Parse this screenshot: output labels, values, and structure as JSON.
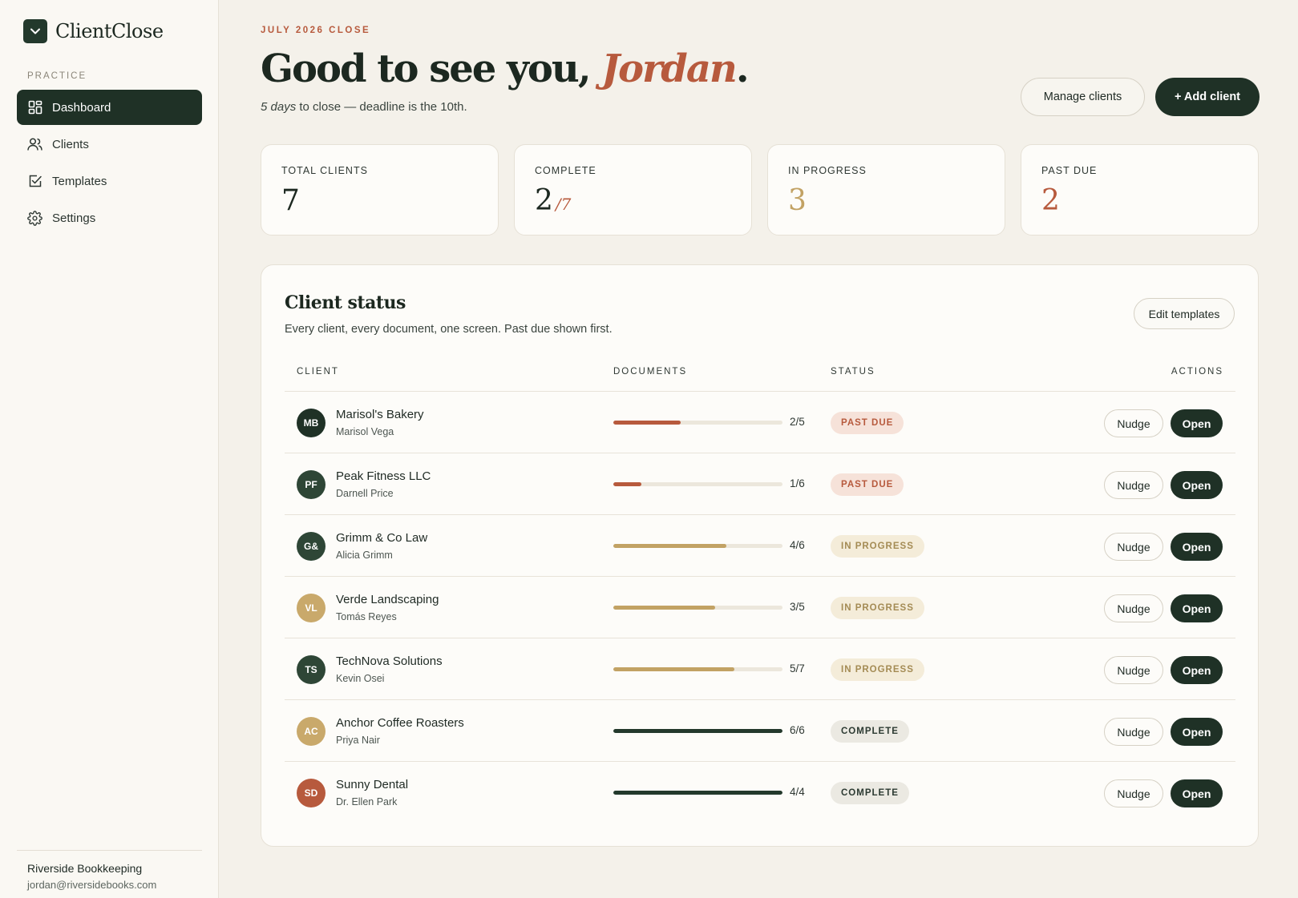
{
  "app": {
    "name": "ClientClose"
  },
  "sidebar": {
    "section_label": "PRACTICE",
    "items": [
      {
        "label": "Dashboard",
        "icon": "dashboard-icon",
        "active": true
      },
      {
        "label": "Clients",
        "icon": "users-icon",
        "active": false
      },
      {
        "label": "Templates",
        "icon": "checkbox-icon",
        "active": false
      },
      {
        "label": "Settings",
        "icon": "gear-icon",
        "active": false
      }
    ],
    "footer": {
      "org": "Riverside Bookkeeping",
      "email": "jordan@riversidebooks.com"
    }
  },
  "header": {
    "eyebrow": "JULY 2026 CLOSE",
    "greeting_prefix": "Good to see you, ",
    "greeting_name": "Jordan",
    "greeting_suffix": ".",
    "sub_emphasis": "5 days",
    "sub_rest": " to close — deadline is the 10th.",
    "manage_label": "Manage clients",
    "add_label": "+ Add client"
  },
  "stats": [
    {
      "label": "TOTAL CLIENTS",
      "value": "7",
      "suffix": "",
      "color": "#1c2820"
    },
    {
      "label": "COMPLETE",
      "value": "2",
      "suffix": "/7",
      "color": "#1c2820"
    },
    {
      "label": "IN PROGRESS",
      "value": "3",
      "suffix": "",
      "color": "#c2a264"
    },
    {
      "label": "PAST DUE",
      "value": "2",
      "suffix": "",
      "color": "#b75a3d"
    }
  ],
  "client_status": {
    "title": "Client status",
    "subtitle": "Every client, every document, one screen. Past due shown first.",
    "edit_label": "Edit templates",
    "columns": [
      "CLIENT",
      "DOCUMENTS",
      "STATUS",
      "ACTIONS"
    ],
    "nudge_label": "Nudge",
    "open_label": "Open",
    "rows": [
      {
        "initials": "MB",
        "avatar_color": "#1f3126",
        "name": "Marisol's Bakery",
        "contact": "Marisol Vega",
        "docs_done": 2,
        "docs_total": 5,
        "docs_label": "2/5",
        "status": "PAST DUE",
        "status_kind": "past",
        "bar_color": "#b75a3d"
      },
      {
        "initials": "PF",
        "avatar_color": "#2e4636",
        "name": "Peak Fitness LLC",
        "contact": "Darnell Price",
        "docs_done": 1,
        "docs_total": 6,
        "docs_label": "1/6",
        "status": "PAST DUE",
        "status_kind": "past",
        "bar_color": "#b75a3d"
      },
      {
        "initials": "G&",
        "avatar_color": "#2e4636",
        "name": "Grimm & Co Law",
        "contact": "Alicia Grimm",
        "docs_done": 4,
        "docs_total": 6,
        "docs_label": "4/6",
        "status": "IN PROGRESS",
        "status_kind": "prog",
        "bar_color": "#c2a264"
      },
      {
        "initials": "VL",
        "avatar_color": "#c9a96b",
        "name": "Verde Landscaping",
        "contact": "Tomás Reyes",
        "docs_done": 3,
        "docs_total": 5,
        "docs_label": "3/5",
        "status": "IN PROGRESS",
        "status_kind": "prog",
        "bar_color": "#c2a264"
      },
      {
        "initials": "TS",
        "avatar_color": "#2e4636",
        "name": "TechNova Solutions",
        "contact": "Kevin Osei",
        "docs_done": 5,
        "docs_total": 7,
        "docs_label": "5/7",
        "status": "IN PROGRESS",
        "status_kind": "prog",
        "bar_color": "#c2a264"
      },
      {
        "initials": "AC",
        "avatar_color": "#c9a96b",
        "name": "Anchor Coffee Roasters",
        "contact": "Priya Nair",
        "docs_done": 6,
        "docs_total": 6,
        "docs_label": "6/6",
        "status": "COMPLETE",
        "status_kind": "comp",
        "bar_color": "#23392c"
      },
      {
        "initials": "SD",
        "avatar_color": "#b75a3d",
        "name": "Sunny Dental",
        "contact": "Dr. Ellen Park",
        "docs_done": 4,
        "docs_total": 4,
        "docs_label": "4/4",
        "status": "COMPLETE",
        "status_kind": "comp",
        "bar_color": "#23392c"
      }
    ]
  }
}
